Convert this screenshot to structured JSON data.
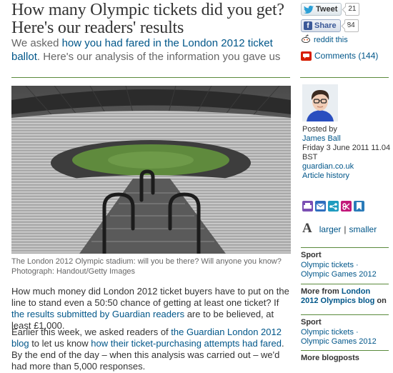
{
  "article": {
    "headline": "How many Olympic tickets did you get? Here's our readers' results",
    "standfirst_pre": "We asked ",
    "standfirst_link": "how you had fared in the London 2012 ticket ballot",
    "standfirst_post": ". Here's our analysis of the information you gave us",
    "caption": "The London 2012 Olympic stadium: will you be there? Will anyone you know? Photograph: Handout/Getty Images",
    "p1_a": "How much money did London 2012 ticket buyers have to put on the line to stand even a 50:50 chance of getting at least one ticket? If ",
    "p1_link": "the results submitted by Guardian readers",
    "p1_b": " are to be believed, at least £1,000.",
    "p2_a": "Earlier this week, we asked readers of ",
    "p2_link1": "the Guardian London 2012 blog",
    "p2_b": " to let us know ",
    "p2_link2": "how their ticket-purchasing attempts had fared",
    "p2_c": ". By the end of the day – when this analysis was carried out – we'd had more than 5,000 responses."
  },
  "social": {
    "tweet_label": "Tweet",
    "tweet_count": "21",
    "share_label": "Share",
    "share_count": "84",
    "reddit_label": "reddit this",
    "comments_label": "Comments (144)"
  },
  "byline": {
    "posted_by": "Posted by",
    "author": "James Ball",
    "date": "Friday 3 June 2011 11.04 BST",
    "site": "guardian.co.uk",
    "history": "Article history"
  },
  "textsize": {
    "glyph": "A",
    "larger": "larger",
    "sep": "|",
    "smaller": "smaller"
  },
  "related": [
    {
      "heading": "Sport",
      "body": "Olympic tickets · Olympic Games 2012"
    },
    {
      "heading_pre": "More from ",
      "heading_link": "London 2012 Olympics blog",
      "heading_post": " on"
    },
    {
      "heading": "Sport",
      "body": "Olympic tickets · Olympic Games 2012"
    },
    {
      "heading": "More blogposts"
    }
  ],
  "colors": {
    "link": "#005689",
    "rule": "#5a8a3c",
    "twitter": "#2a9fd6",
    "facebook": "#3b5998",
    "comments": "#d61d00"
  }
}
